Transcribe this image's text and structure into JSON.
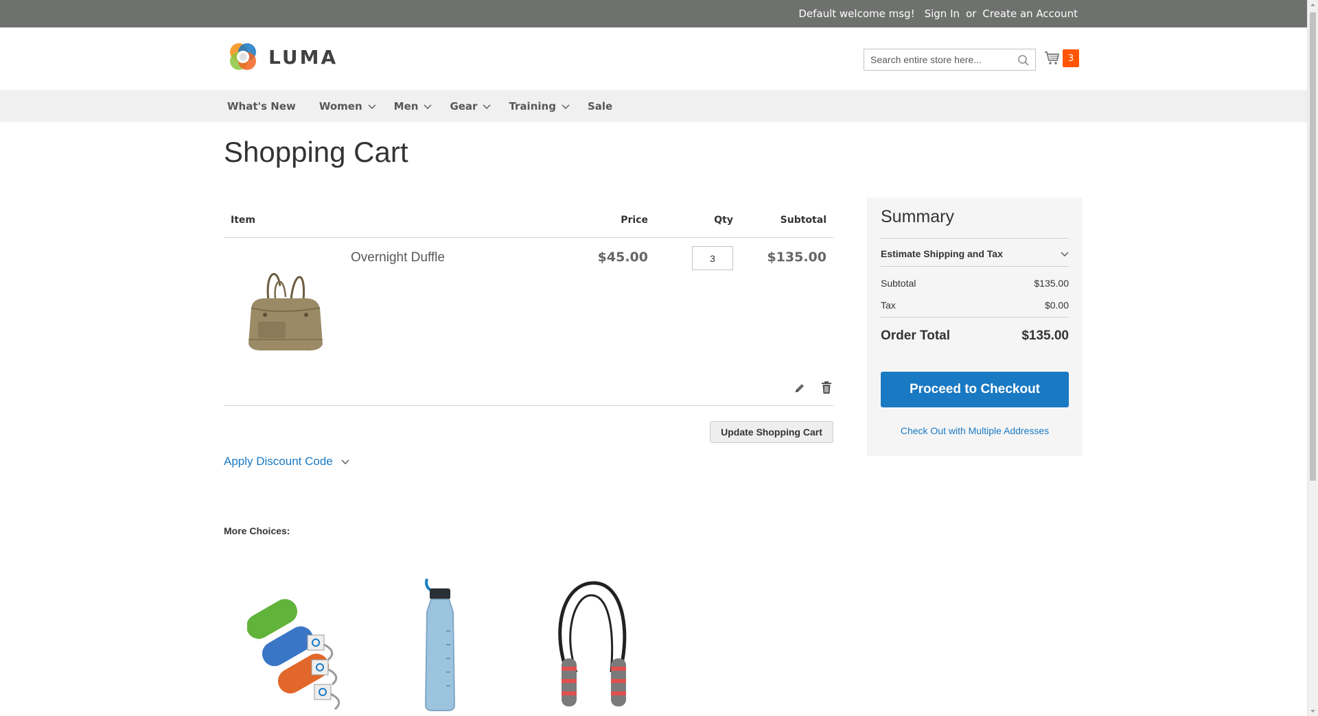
{
  "header": {
    "welcome": "Default welcome msg!",
    "sign_in": "Sign In",
    "or": "or",
    "create_account": "Create an Account",
    "logo_text": "LUMA",
    "search_placeholder": "Search entire store here...",
    "cart_count": "3"
  },
  "nav": {
    "items": [
      {
        "label": "What's New"
      },
      {
        "label": "Women"
      },
      {
        "label": "Men"
      },
      {
        "label": "Gear"
      },
      {
        "label": "Training"
      },
      {
        "label": "Sale"
      }
    ]
  },
  "page": {
    "title": "Shopping Cart"
  },
  "cart": {
    "headers": {
      "item": "Item",
      "price": "Price",
      "qty": "Qty",
      "subtotal": "Subtotal"
    },
    "items": [
      {
        "name": "Overnight Duffle",
        "price": "$45.00",
        "qty": "3",
        "subtotal": "$135.00"
      }
    ],
    "update_label": "Update Shopping Cart",
    "discount_label": "Apply Discount Code"
  },
  "summary": {
    "title": "Summary",
    "estimate_label": "Estimate Shipping and Tax",
    "subtotal_label": "Subtotal",
    "subtotal_value": "$135.00",
    "tax_label": "Tax",
    "tax_value": "$0.00",
    "total_label": "Order Total",
    "total_value": "$135.00",
    "checkout_label": "Proceed to Checkout",
    "multi_label": "Check Out with Multiple Addresses"
  },
  "more": {
    "title": "More Choices:"
  },
  "colors": {
    "accent": "#1979c3",
    "cart_badge": "#ff5501",
    "top_bar": "#6e716e",
    "nav_bg": "#f0f0f0"
  }
}
